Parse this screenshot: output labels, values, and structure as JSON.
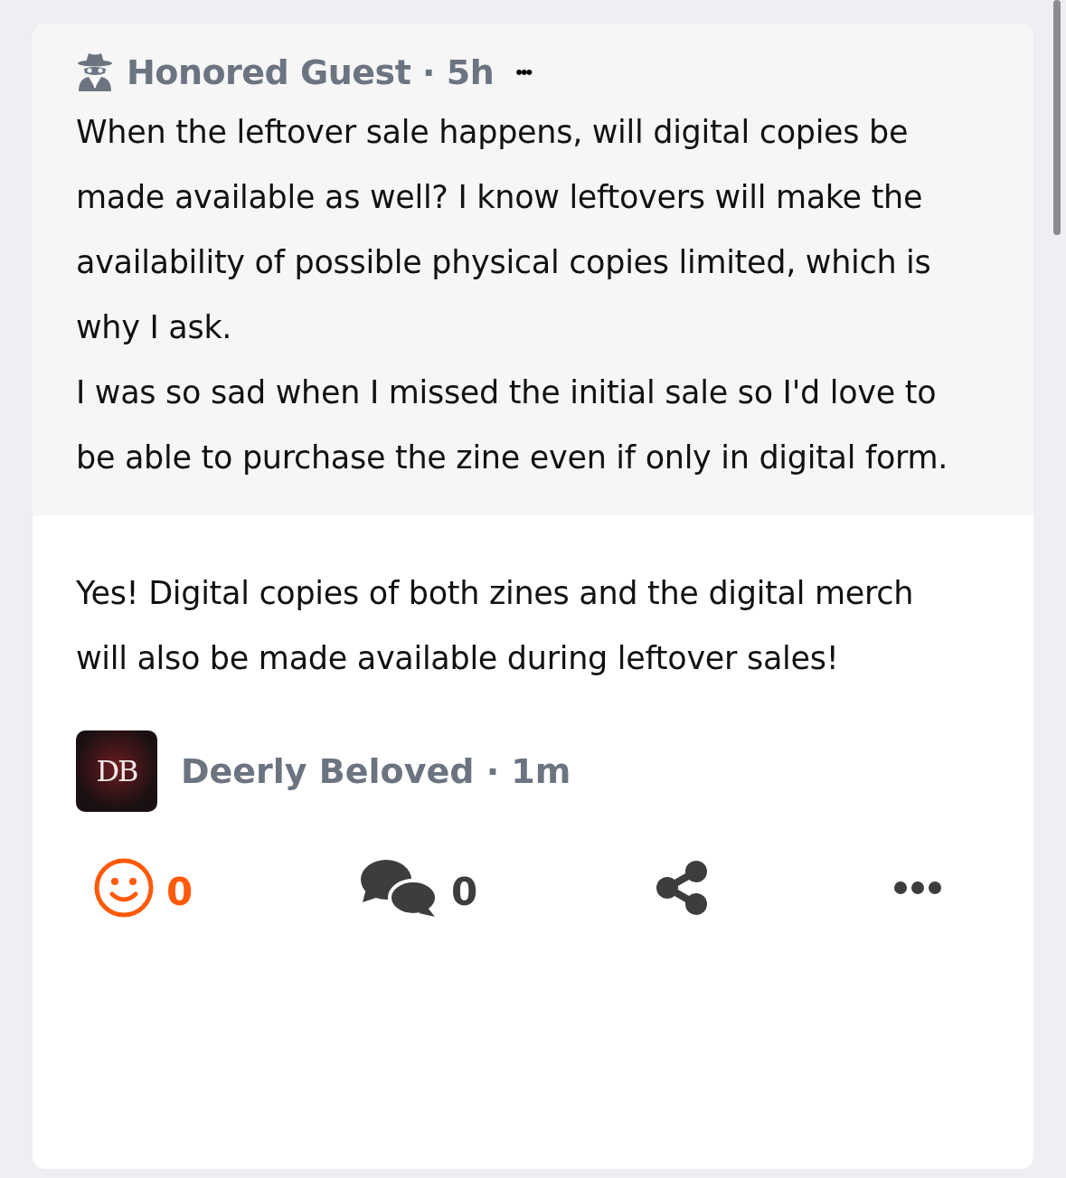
{
  "question": {
    "byline": "Honored Guest · 5h",
    "menu": "•••",
    "paragraphs": [
      "When the leftover sale happens, will digital copies be made available as well? I know leftovers will make the availability of possible physical copies limited, which is why I ask.",
      "I was so sad when I missed the initial sale so I'd love to be able to purchase the zine even if only in digital form."
    ]
  },
  "answer": {
    "text": "Yes! Digital copies of both zines and the digital merch will also be made available during leftover sales!",
    "byline": "Deerly Beloved · 1m",
    "avatar_text": "DB"
  },
  "actions": [
    {
      "kind": "react",
      "count": "0"
    },
    {
      "kind": "comment",
      "count": "0"
    },
    {
      "kind": "share"
    },
    {
      "kind": "more"
    }
  ]
}
